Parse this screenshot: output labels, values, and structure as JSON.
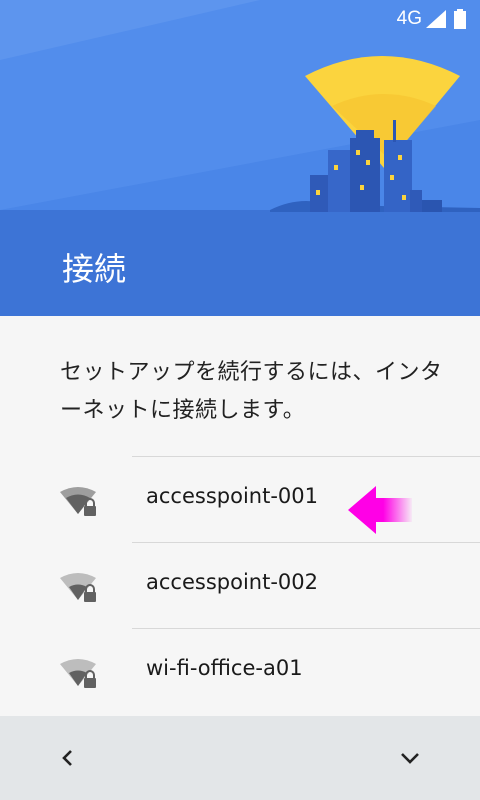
{
  "status_bar": {
    "network": "4G"
  },
  "header": {
    "title": "接続"
  },
  "instruction": "セットアップを続行するには、インターネットに接続します。",
  "networks": [
    {
      "ssid": "accesspoint-001",
      "signal": "medium"
    },
    {
      "ssid": "accesspoint-002",
      "signal": "weak"
    },
    {
      "ssid": "wi-fi-office-a01",
      "signal": "weak"
    }
  ],
  "navigation": {
    "back_icon": "chevron-left-icon",
    "next_icon": "chevron-down-icon"
  },
  "colors": {
    "header": "#4a86e8",
    "header_dark": "#3d74d6",
    "annotation_arrow": "#ff00e6",
    "sun": "#fbd43e"
  }
}
